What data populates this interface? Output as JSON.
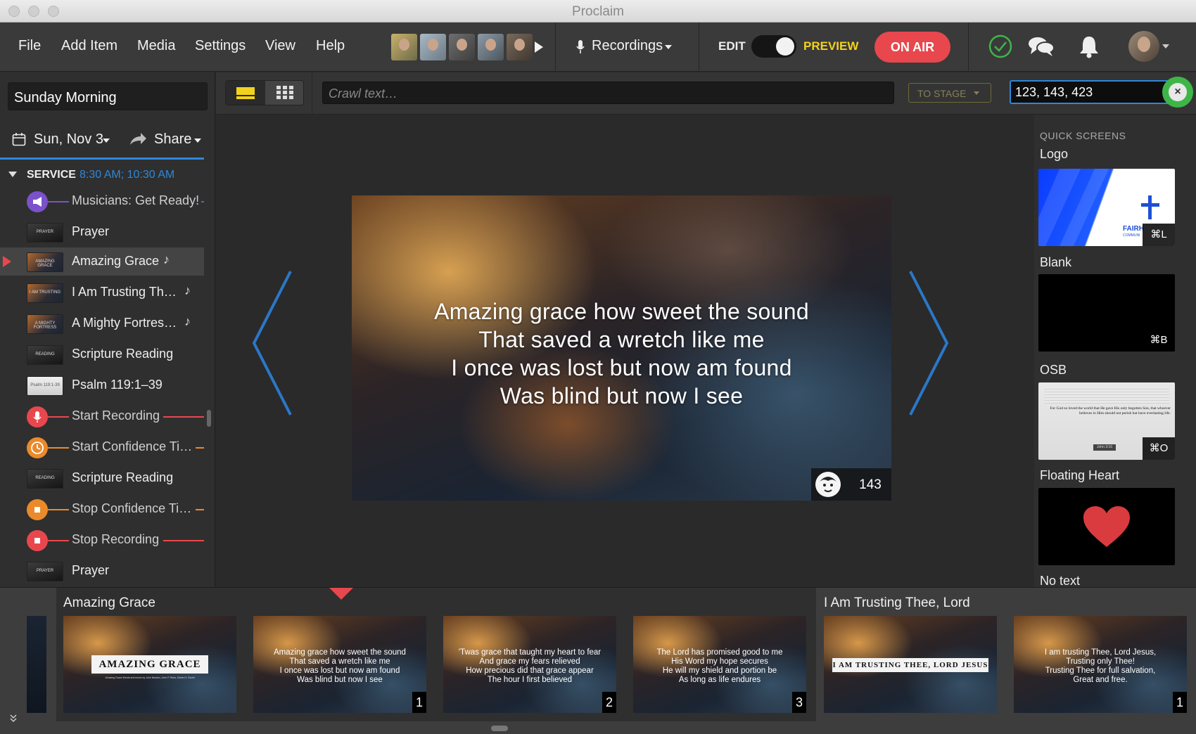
{
  "window": {
    "title": "Proclaim"
  },
  "menu": {
    "file": "File",
    "add_item": "Add Item",
    "media": "Media",
    "settings": "Settings",
    "view": "View",
    "help": "Help"
  },
  "header": {
    "recordings": "Recordings",
    "edit": "EDIT",
    "preview": "PREVIEW",
    "on_air": "ON AIR",
    "accent": "#e8474d",
    "preview_color": "#f3d21c",
    "status_color": "#3fb549"
  },
  "sidebar": {
    "service_name": "Sunday Morning",
    "date": "Sun, Nov 3",
    "share": "Share",
    "section": "SERVICE",
    "times": "8:30 AM; 10:30 AM",
    "items": [
      {
        "label": "Musicians: Get Ready!",
        "type": "cue",
        "icon": "megaphone-icon",
        "color": "#7b52c9"
      },
      {
        "label": "Prayer",
        "type": "slide",
        "thumb_text": "PRAYER"
      },
      {
        "label": "Amazing Grace",
        "type": "song",
        "thumb_text": "AMAZING GRACE",
        "selected": true
      },
      {
        "label": "I Am Trusting Th…",
        "type": "song",
        "thumb_text": "I AM TRUSTING"
      },
      {
        "label": "A Mighty Fortres…",
        "type": "song",
        "thumb_text": "A MIGHTY FORTRESS"
      },
      {
        "label": "Scripture Reading",
        "type": "slide",
        "thumb_text": "READING"
      },
      {
        "label": "Psalm 119:1–39",
        "type": "bible",
        "thumb_text": "Psalm 119:1-39"
      },
      {
        "label": "Start Recording",
        "type": "cue",
        "icon": "microphone-icon",
        "color": "#e8474d"
      },
      {
        "label": "Start Confidence Ti…",
        "type": "cue",
        "icon": "clock-icon",
        "color": "#ea8a2a"
      },
      {
        "label": "Scripture Reading",
        "type": "slide",
        "thumb_text": "READING"
      },
      {
        "label": "Stop Confidence Ti…",
        "type": "cue",
        "icon": "stop-icon",
        "color": "#ea8a2a"
      },
      {
        "label": "Stop Recording",
        "type": "cue",
        "icon": "stop-icon",
        "color": "#e8474d"
      },
      {
        "label": "Prayer",
        "type": "slide",
        "thumb_text": "PRAYER"
      }
    ]
  },
  "toolbar": {
    "crawl_placeholder": "Crawl text…",
    "to_stage": "TO STAGE",
    "numbers_value": "123, 143, 423"
  },
  "stage": {
    "lyrics": [
      "Amazing grace how sweet the sound",
      "That saved a wretch like me",
      "I once was lost but now am found",
      "Was blind but now I see"
    ],
    "badge_count": "143"
  },
  "quick_screens": {
    "title": "QUICK SCREENS",
    "items": [
      {
        "label": "Logo",
        "shortcut": "⌘L",
        "logo_text": "FAIRH",
        "logo_sub": "COMMUNI"
      },
      {
        "label": "Blank",
        "shortcut": "⌘B"
      },
      {
        "label": "OSB",
        "shortcut": "⌘O",
        "verse": "For God so loved the world that He gave His only begotten Son, that whoever believes in Him should not perish but have everlasting life.",
        "ref": "John 3:16"
      },
      {
        "label": "Floating Heart"
      },
      {
        "label": "No text"
      }
    ]
  },
  "strip": {
    "groups": [
      {
        "title": "Amazing Grace",
        "slides": [
          {
            "kind": "title",
            "title": "AMAZING GRACE",
            "credit": "Amazing Grace Words and music by John Newton, John P. Rees, Edwin O. Excell"
          },
          {
            "kind": "lyrics",
            "num": "1",
            "lines": [
              "Amazing grace how sweet the sound",
              "That saved a wretch like me",
              "I once was lost but now am found",
              "Was blind but now I see"
            ]
          },
          {
            "kind": "lyrics",
            "num": "2",
            "lines": [
              "'Twas grace that taught my heart to fear",
              "And grace my fears relieved",
              "How precious did that grace appear",
              "The hour I first believed"
            ]
          },
          {
            "kind": "lyrics",
            "num": "3",
            "lines": [
              "The Lord has promised good to me",
              "His Word my hope secures",
              "He will my shield and portion be",
              "As long as life endures"
            ]
          }
        ]
      },
      {
        "title": "I Am Trusting Thee, Lord",
        "slides": [
          {
            "kind": "title",
            "title": "I AM TRUSTING THEE, LORD JESUS"
          },
          {
            "kind": "lyrics",
            "num": "1",
            "lines": [
              "I am trusting Thee, Lord Jesus,",
              "Trusting only Thee!",
              "Trusting Thee for full salvation,",
              "Great and free."
            ]
          }
        ]
      }
    ]
  }
}
